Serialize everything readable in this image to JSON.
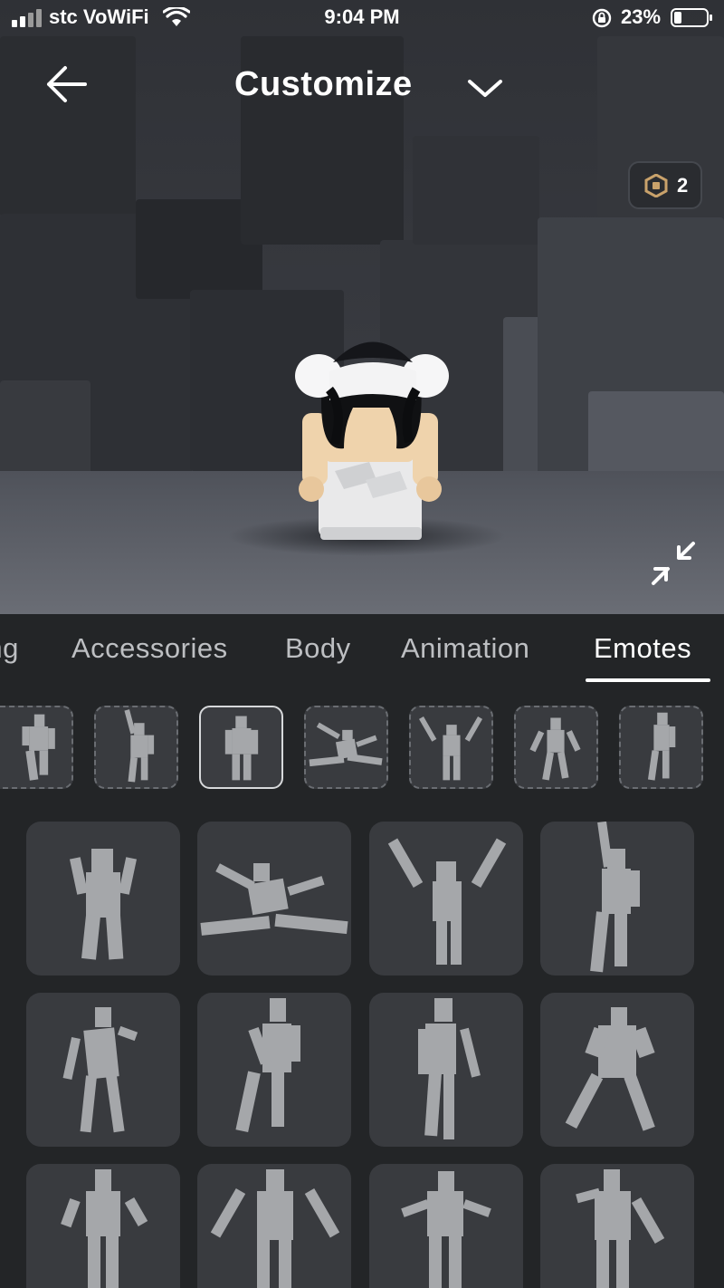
{
  "status_bar": {
    "carrier": "stc VoWiFi",
    "time": "9:04 PM",
    "battery_percent": "23%",
    "battery_level": 0.23,
    "icons": [
      "signal-icon",
      "wifi-icon",
      "rotation-lock-icon",
      "battery-icon"
    ]
  },
  "header": {
    "title": "Customize",
    "back_icon": "arrow-left-icon",
    "dropdown_icon": "chevron-down-icon"
  },
  "currency": {
    "icon": "robux-icon",
    "amount": "2",
    "accent": "#c9a26b"
  },
  "viewport": {
    "collapse_icon": "collapse-arrows-icon"
  },
  "tabs": [
    {
      "label": "ing",
      "active": false
    },
    {
      "label": "Accessories",
      "active": false
    },
    {
      "label": "Body",
      "active": false
    },
    {
      "label": "Animation",
      "active": false
    },
    {
      "label": "Emotes",
      "active": true
    }
  ],
  "equipped_slots": [
    {
      "icon": "emote-pose-1-icon",
      "selected": false
    },
    {
      "icon": "emote-pose-2-icon",
      "selected": false
    },
    {
      "icon": "emote-pose-3-icon",
      "selected": true
    },
    {
      "icon": "emote-pose-4-icon",
      "selected": false
    },
    {
      "icon": "emote-pose-5-icon",
      "selected": false
    },
    {
      "icon": "emote-pose-6-icon",
      "selected": false
    },
    {
      "icon": "emote-pose-7-icon",
      "selected": false
    }
  ],
  "emotes": [
    {
      "icon": "emote-shrug-stand-icon"
    },
    {
      "icon": "emote-split-jump-icon"
    },
    {
      "icon": "emote-arms-up-icon"
    },
    {
      "icon": "emote-point-up-icon"
    },
    {
      "icon": "emote-dance-1-icon"
    },
    {
      "icon": "emote-hand-hip-icon"
    },
    {
      "icon": "emote-walk-icon"
    },
    {
      "icon": "emote-dance-2-icon"
    },
    {
      "icon": "emote-dance-3-icon"
    },
    {
      "icon": "emote-arms-out-icon"
    },
    {
      "icon": "emote-shrug-icon"
    },
    {
      "icon": "emote-dance-4-icon"
    }
  ],
  "colors": {
    "panel": "#232527",
    "card": "#393b3f",
    "figure": "#a5a7aa",
    "active_tab": "#ffffff",
    "inactive_tab": "#bdbfc2"
  }
}
